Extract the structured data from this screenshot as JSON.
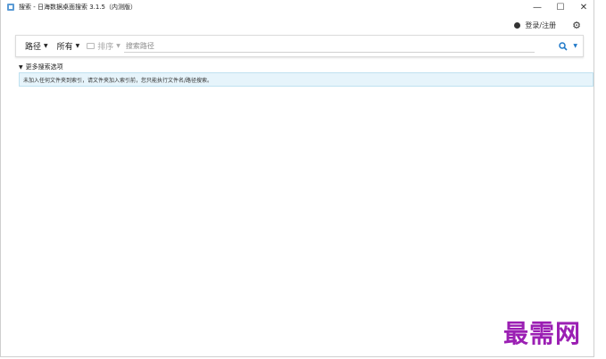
{
  "window": {
    "title": "搜索 - 日海数据桌面搜索 3.1.5（内测版）",
    "controls": {
      "minimize": "—",
      "maximize": "☐",
      "close": "✕"
    }
  },
  "topbar": {
    "login_label": "登录/注册",
    "settings_icon": "gear-icon"
  },
  "search": {
    "path_label": "路径",
    "scope_label": "所有",
    "sort_label": "排序",
    "placeholder": "搜索路径",
    "value": ""
  },
  "options": {
    "more_label": "更多搜索选项"
  },
  "info": {
    "message": "未加入任何文件夹到索引，请文件夹加入索引前，您只能执行文件名/路径搜索。"
  },
  "watermark": "最需网",
  "colors": {
    "accent": "#1e78c8",
    "info_bg": "#e6f4fb",
    "watermark": "#9b1fb3"
  }
}
